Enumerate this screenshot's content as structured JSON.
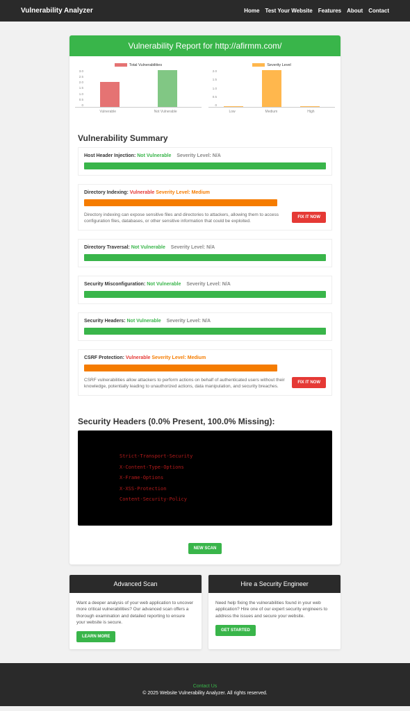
{
  "nav": {
    "brand": "Vulnerability Analyzer",
    "links": [
      "Home",
      "Test Your Website",
      "Features",
      "About",
      "Contact"
    ]
  },
  "report_title": "Vulnerability Report for http://afirmm.com/",
  "chart_data": [
    {
      "type": "bar",
      "title": "Total Vulnerabilities",
      "categories": [
        "Vulnerable",
        "Not Vulnerable"
      ],
      "values": [
        2,
        3
      ],
      "ylim": [
        0,
        3
      ],
      "ticks": [
        "3.0",
        "2.5",
        "2.0",
        "1.5",
        "1.0",
        "0.5",
        "0"
      ],
      "colors": [
        "#e57373",
        "#81c784"
      ]
    },
    {
      "type": "bar",
      "title": "Severity Level",
      "categories": [
        "Low",
        "Medium",
        "High"
      ],
      "values": [
        0,
        2,
        0
      ],
      "ylim": [
        0,
        2
      ],
      "ticks": [
        "2.0",
        "1.5",
        "1.0",
        "0.5",
        "0"
      ],
      "colors": [
        "#ffb74d"
      ]
    }
  ],
  "summary_title": "Vulnerability Summary",
  "vulns": [
    {
      "name": "Host Header Injection:",
      "status": "Not Vulnerable",
      "status_class": "not-vuln",
      "sev_label": "Severity Level: N/A",
      "bar": "green",
      "desc": "",
      "fix": false
    },
    {
      "name": "Directory Indexing:",
      "status": "Vulnerable",
      "status_class": "is-vuln",
      "sev_label": "Severity Level: Medium",
      "sev_class": "sev-med",
      "bar": "orange",
      "desc": "Directory indexing can expose sensitive files and directories to attackers, allowing them to access configuration files, databases, or other sensitive information that could be exploited.",
      "fix": true
    },
    {
      "name": "Directory Traversal:",
      "status": "Not Vulnerable",
      "status_class": "not-vuln",
      "sev_label": "Severity Level: N/A",
      "bar": "green",
      "desc": "",
      "fix": false
    },
    {
      "name": "Security Misconfiguration:",
      "status": "Not Vulnerable",
      "status_class": "not-vuln",
      "sev_label": "Severity Level: N/A",
      "bar": "green",
      "desc": "",
      "fix": false
    },
    {
      "name": "Security Headers:",
      "status": "Not Vulnerable",
      "status_class": "not-vuln",
      "sev_label": "Severity Level: N/A",
      "bar": "green",
      "desc": "",
      "fix": false
    },
    {
      "name": "CSRF Protection:",
      "status": "Vulnerable",
      "status_class": "is-vuln",
      "sev_label": "Severity Level: Medium",
      "sev_class": "sev-med",
      "bar": "orange",
      "desc": "CSRF vulnerabilities allow attackers to perform actions on behalf of authenticated users without their knowledge, potentially leading to unauthorized actions, data manipulation, and security breaches.",
      "fix": true
    }
  ],
  "fix_button": "FIX IT NOW",
  "headers_title": "Security Headers (0.0% Present, 100.0% Missing):",
  "headers_list": [
    "Strict-Transport-Security",
    "X-Content-Type-Options",
    "X-Frame-Options",
    "X-XSS-Protection",
    "Content-Security-Policy"
  ],
  "new_scan": "NEW SCAN",
  "promos": [
    {
      "title": "Advanced Scan",
      "text": "Want a deeper analysis of your web application to uncover more critical vulnerabilities? Our advanced scan offers a thorough examination and detailed reporting to ensure your website is secure.",
      "cta": "LEARN MORE"
    },
    {
      "title": "Hire a Security Engineer",
      "text": "Need help fixing the vulnerabilities found in your web application? Hire one of our expert security engineers to address the issues and secure your website.",
      "cta": "GET STARTED"
    }
  ],
  "footer": {
    "contact": "Contact Us",
    "copy": "© 2025 Website Vulnerability Analyzer. All rights reserved."
  }
}
